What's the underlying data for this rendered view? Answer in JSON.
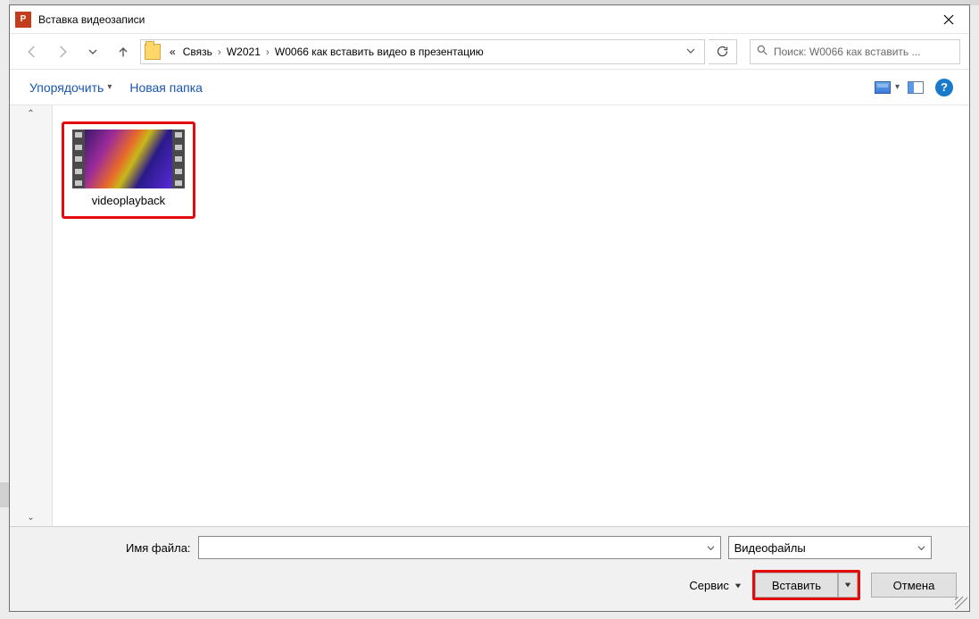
{
  "title": "Вставка видеозаписи",
  "breadcrumb": {
    "prefix": "«",
    "items": [
      "Связь",
      "W2021",
      "W0066 как вставить видео в презентацию"
    ]
  },
  "search": {
    "placeholder": "Поиск: W0066 как вставить ..."
  },
  "toolbar": {
    "organize": "Упорядочить",
    "new_folder": "Новая папка"
  },
  "files": [
    {
      "name": "videoplayback"
    }
  ],
  "bottom": {
    "filename_label": "Имя файла:",
    "filename_value": "",
    "filetype": "Видеофайлы",
    "tools": "Сервис",
    "insert": "Вставить",
    "cancel": "Отмена"
  }
}
